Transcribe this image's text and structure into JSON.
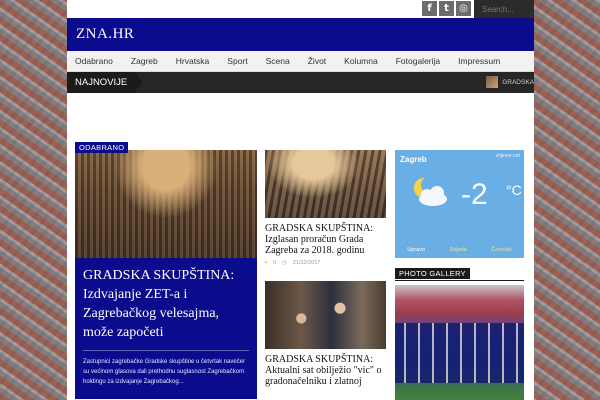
{
  "header": {
    "social": [
      {
        "icon": "facebook-icon",
        "glyph": "f"
      },
      {
        "icon": "twitter-icon",
        "glyph": "t"
      },
      {
        "icon": "instagram-icon",
        "glyph": "◎"
      }
    ],
    "search_placeholder": "Search...",
    "logo": "ZNA.HR"
  },
  "nav": [
    "Odabrano",
    "Zagreb",
    "Hrvatska",
    "Sport",
    "Scena",
    "Život",
    "Kolumna",
    "Fotogalerija",
    "Impressum"
  ],
  "ticker": {
    "label": "NAJNOVIJE",
    "item": "GRADSKA"
  },
  "featured": {
    "badge": "ODABRANO",
    "title": "GRADSKA SKUPŠTINA: Izdvajanje ZET-a i Zagrebačkog velesajma, može započeti",
    "excerpt": "Zastupnici zagrebačke Gradske skupštine u četvrtak navečer su većinom glasova dali prethodnu suglasnost Zagrebačkom holdingu za izdvajanje Zagrebačkog..."
  },
  "articles": [
    {
      "title": "GRADSKA SKUPŠTINA: Izglasan proračun Grada Zagreba za 2018. godinu",
      "comments": "0",
      "date": "21/12/2017"
    },
    {
      "title": "GRADSKA SKUPŠTINA: Aktualni sat obilježio \"vic\" o gradonačelniku i zlatnoj"
    }
  ],
  "weather": {
    "city": "Zagreb",
    "source": "vrijeme.net",
    "temperature": "-2",
    "unit": "°C",
    "days": [
      "Upravo",
      "Srijeda",
      "Četvrtak"
    ]
  },
  "photo_gallery": {
    "label": "PHOTO GALLERY"
  },
  "colors": {
    "brand": "#0b0b8e",
    "weather": "#6aaee6"
  }
}
